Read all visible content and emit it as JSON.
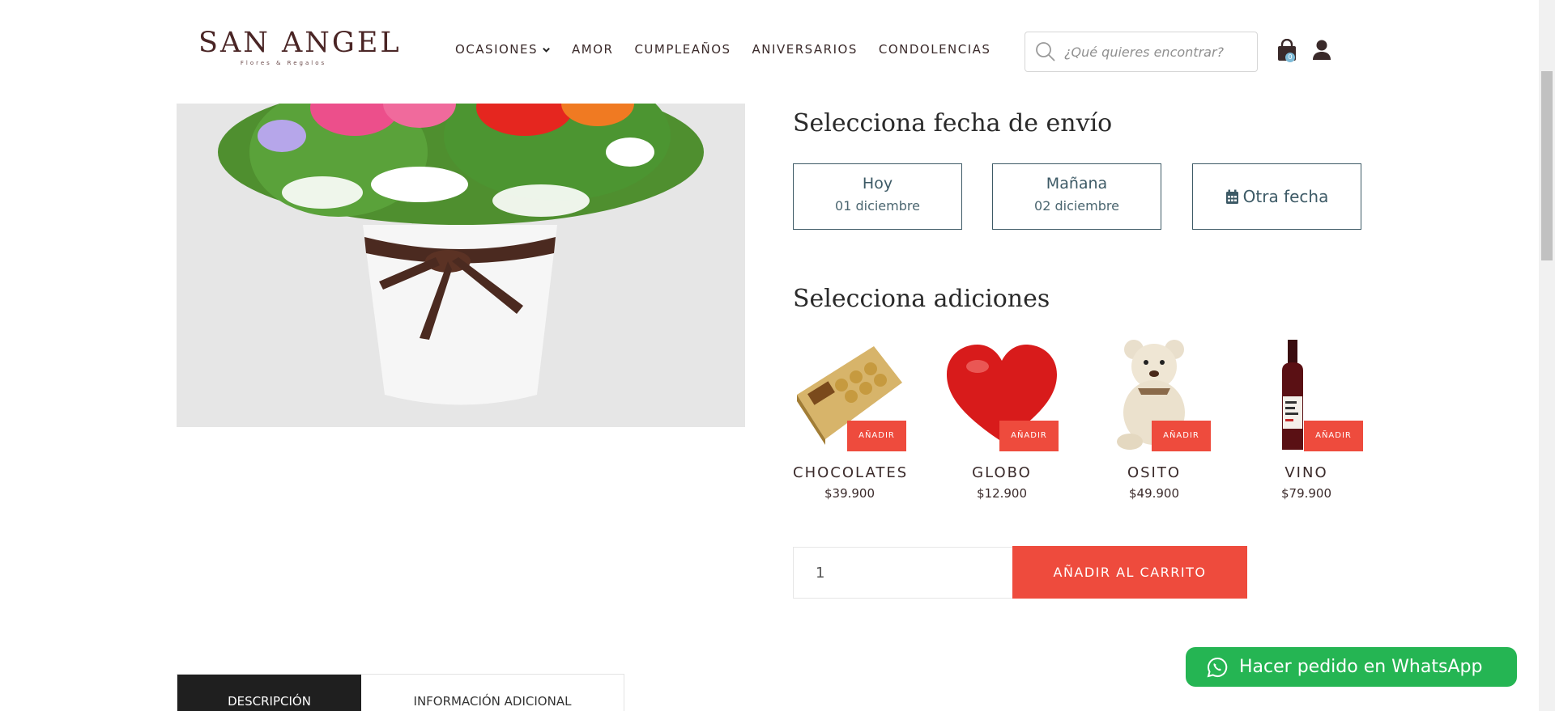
{
  "brand": {
    "name": "SAN ANGEL",
    "tagline": "Flores & Regalos"
  },
  "nav": {
    "items": [
      {
        "label": "OCASIONES",
        "has_dropdown": true
      },
      {
        "label": "AMOR"
      },
      {
        "label": "CUMPLEAÑOS"
      },
      {
        "label": "ANIVERSARIOS"
      },
      {
        "label": "CONDOLENCIAS"
      }
    ]
  },
  "search": {
    "placeholder": "¿Qué quieres encontrar?"
  },
  "cart": {
    "count": "0"
  },
  "shipping": {
    "heading": "Selecciona fecha de envío",
    "options": [
      {
        "title": "Hoy",
        "date": "01 diciembre"
      },
      {
        "title": "Mañana",
        "date": "02 diciembre"
      },
      {
        "title": "Otra fecha",
        "icon": "calendar-icon"
      }
    ]
  },
  "addons": {
    "heading": "Selecciona adiciones",
    "button_label": "AÑADIR",
    "items": [
      {
        "name": "CHOCOLATES",
        "price": "$39.900"
      },
      {
        "name": "GLOBO",
        "price": "$12.900"
      },
      {
        "name": "OSITO",
        "price": "$49.900"
      },
      {
        "name": "VINO",
        "price": "$79.900"
      }
    ]
  },
  "purchase": {
    "quantity": "1",
    "add_to_cart_label": "AÑADIR AL CARRITO"
  },
  "tabs": [
    {
      "label": "DESCRIPCIÓN",
      "active": true
    },
    {
      "label": "INFORMACIÓN ADICIONAL"
    }
  ],
  "whatsapp": {
    "label": "Hacer pedido en WhatsApp"
  },
  "colors": {
    "accent": "#ee4b3d",
    "date_border": "#3d5a66",
    "whatsapp": "#25b553",
    "brand": "#4a2525"
  }
}
